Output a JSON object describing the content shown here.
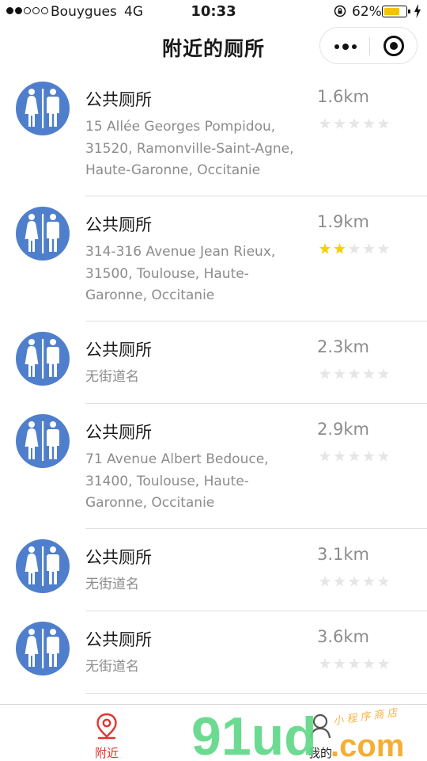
{
  "status_bar": {
    "carrier": "Bouygues",
    "network": "4G",
    "time": "10:33",
    "battery_percent_label": "62%",
    "battery_level": 0.62,
    "signal_strength": 2,
    "battery_color": "#f4c400"
  },
  "nav": {
    "title": "附近的厕所",
    "menu_icon": "more-dots-icon",
    "close_icon": "target-icon"
  },
  "toilets": [
    {
      "name": "公共厕所",
      "address": "15 Allée Georges Pompidou,\n31520, Ramonville-Saint-Agne,\nHaute-Garonne, Occitanie",
      "distance": "1.6km",
      "rating": 0
    },
    {
      "name": "公共厕所",
      "address": "314-316 Avenue Jean Rieux,\n31500, Toulouse, Haute-\nGaronne, Occitanie",
      "distance": "1.9km",
      "rating": 2
    },
    {
      "name": "公共厕所",
      "address": "无街道名",
      "distance": "2.3km",
      "rating": 0
    },
    {
      "name": "公共厕所",
      "address": "71 Avenue Albert Bedouce,\n31400, Toulouse, Haute-\nGaronne, Occitanie",
      "distance": "2.9km",
      "rating": 0
    },
    {
      "name": "公共厕所",
      "address": "无街道名",
      "distance": "3.1km",
      "rating": 0
    },
    {
      "name": "公共厕所",
      "address": "无街道名",
      "distance": "3.6km",
      "rating": 0
    }
  ],
  "rating_max": 5,
  "colors": {
    "icon_blue": "#4f7fcc",
    "star_active": "#f5d000",
    "star_inactive": "#e6e6e6",
    "tab_active": "#e03530",
    "watermark_green": "#5fd888",
    "watermark_orange": "#f5a623"
  },
  "tabs": [
    {
      "label": "附近",
      "icon": "location-pin-icon",
      "active": true
    },
    {
      "label": "我的",
      "icon": "user-icon",
      "active": false
    }
  ],
  "watermark": {
    "brand": "91ud.com",
    "tagline": "小程序商店"
  }
}
